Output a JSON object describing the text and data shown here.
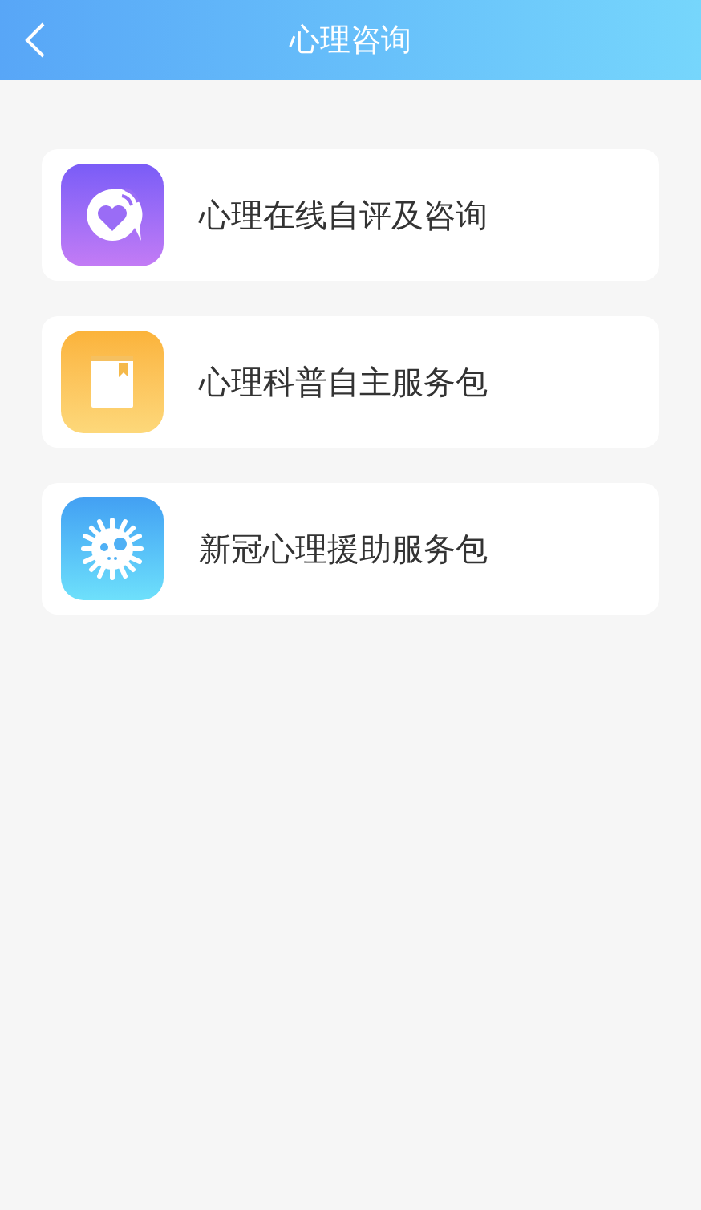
{
  "header": {
    "title": "心理咨询"
  },
  "items": [
    {
      "kind": "chat",
      "label": "心理在线自评及咨询"
    },
    {
      "kind": "book",
      "label": "心理科普自主服务包"
    },
    {
      "kind": "virus",
      "label": "新冠心理援助服务包"
    }
  ]
}
